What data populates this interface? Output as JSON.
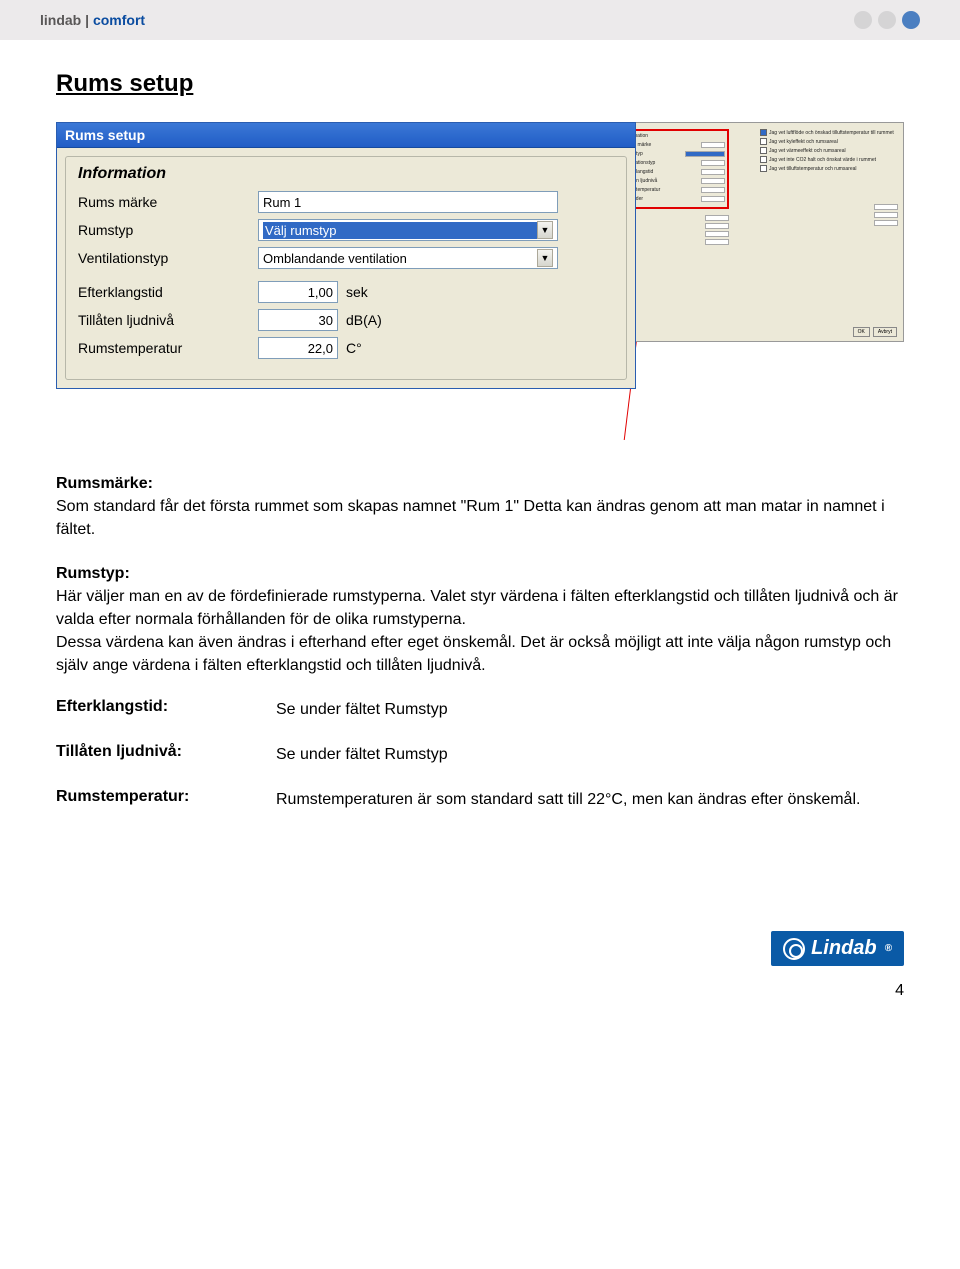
{
  "header": {
    "brand": "lindab",
    "separator": "|",
    "section": "comfort"
  },
  "title": "Rums setup",
  "dialog": {
    "window_title": "Rums setup",
    "group_title": "Information",
    "fields": {
      "rums_marke": {
        "label": "Rums märke",
        "value": "Rum 1"
      },
      "rumstyp": {
        "label": "Rumstyp",
        "value": "Välj rumstyp"
      },
      "ventilationstyp": {
        "label": "Ventilationstyp",
        "value": "Omblandande ventilation"
      },
      "efterklangstid": {
        "label": "Efterklangstid",
        "value": "1,00",
        "unit": "sek"
      },
      "tillaten_ljudniva": {
        "label": "Tillåten ljudnivå",
        "value": "30",
        "unit": "dB(A)"
      },
      "rumstemperatur": {
        "label": "Rumstemperatur",
        "value": "22,0",
        "unit": "C°"
      }
    }
  },
  "thumb": {
    "left_labels": [
      "Information",
      "Rums märke",
      "Rumstyp",
      "Ventilationstyp",
      "Efterklangstid",
      "Tillåten ljudnivå",
      "Rumstemperatur",
      "Bostäder"
    ],
    "checks": [
      "Jag vet luftflöde och önskad tilluftstemperatur till rummet",
      "Jag vet kyleffekt och rumsareal",
      "Jag vet värmeeffekt och rumsareal",
      "Jag vet inte CO2 halt och önskat värde i rummet",
      "Jag vet tilluftstemperatur och rumsareal"
    ],
    "btn_ok": "OK",
    "btn_cancel": "Avbryt"
  },
  "descriptions": {
    "rumsmarke": {
      "title": "Rumsmärke:",
      "body": "Som standard får det första rummet som skapas namnet \"Rum 1\" Detta kan ändras genom att man matar in namnet i fältet."
    },
    "rumstyp": {
      "title": "Rumstyp:",
      "body": "Här väljer man en av de fördefinierade rumstyperna. Valet styr värdena i fälten efterklangstid och tillåten ljudnivå och är valda efter normala förhållanden för de olika rumstyperna.\nDessa värdena kan även ändras i efterhand efter eget önskemål. Det är också möjligt att inte välja någon rumstyp och själv ange värdena i fälten efterklangstid och tillåten ljudnivå."
    },
    "rows": {
      "efterklangstid": {
        "label": "Efterklangstid:",
        "value": "Se under fältet Rumstyp"
      },
      "tillaten": {
        "label": "Tillåten ljudnivå:",
        "value": "Se under fältet Rumstyp"
      },
      "rumstemp": {
        "label": "Rumstemperatur:",
        "value": "Rumstemperaturen är som standard satt till 22°C, men kan ändras efter önskemål."
      }
    }
  },
  "logo_text": "Lindab",
  "page_number": "4"
}
